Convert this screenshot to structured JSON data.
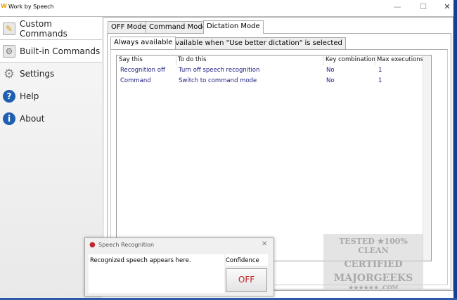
{
  "window": {
    "title": "Work by Speech",
    "logo": "W",
    "minimize": "—",
    "maximize": "☐",
    "close": "✕"
  },
  "sidebar": {
    "items": [
      {
        "label": "Custom Commands",
        "icon": "notepad-pencil-icon"
      },
      {
        "label": "Built-in Commands",
        "icon": "document-gear-icon"
      },
      {
        "label": "Settings",
        "icon": "gear-icon"
      },
      {
        "label": "Help",
        "icon": "help-icon",
        "glyph": "?"
      },
      {
        "label": "About",
        "icon": "info-icon",
        "glyph": "i"
      }
    ]
  },
  "mode_tabs": [
    "OFF Mode",
    "Command Mode",
    "Dictation Mode"
  ],
  "sub_tabs": [
    "Always available",
    "Available when \"Use better dictation\" is selected"
  ],
  "table": {
    "headers": [
      "Say this",
      "To do this",
      "Key combination",
      "Max executions"
    ],
    "rows": [
      [
        "Recognition off",
        "Turn off speech recognition",
        "No",
        "1"
      ],
      [
        "Command",
        "Switch to command mode",
        "No",
        "1"
      ]
    ]
  },
  "speech_dialog": {
    "title": "Speech Recognition",
    "close": "✕",
    "recognized": "Recognized speech appears here.",
    "confidence_label": "Confidence",
    "toggle": "OFF"
  },
  "watermark": {
    "line1": "TESTED ★100% CLEAN",
    "line2": "CERTIFIED",
    "line3": "MAJORGEEKS",
    "line4": "★★★★★★ .COM"
  }
}
